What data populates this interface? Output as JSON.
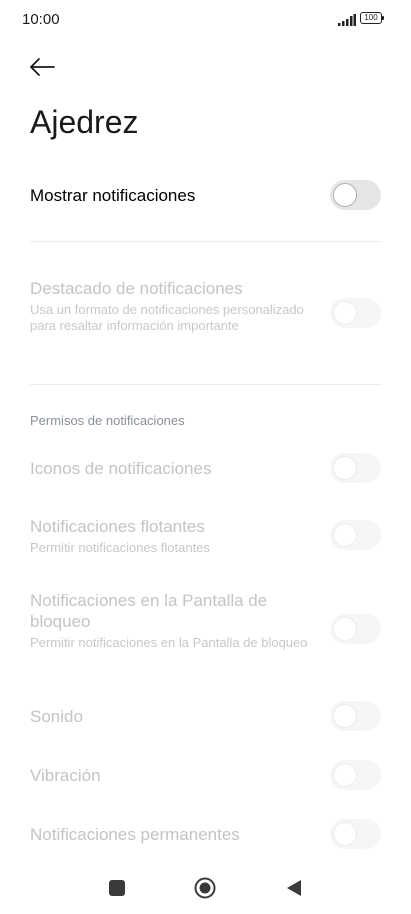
{
  "status_bar": {
    "time": "10:00",
    "battery": "100"
  },
  "header": {
    "back_icon": "arrow-left-icon",
    "title": "Ajedrez"
  },
  "settings": {
    "show_notifications": {
      "title": "Mostrar notificaciones",
      "enabled": false
    },
    "highlight": {
      "title": "Destacado de notificaciones",
      "subtitle": "Usa un formato de notificaciones personalizado para resaltar información importante",
      "enabled": false
    },
    "section_header": "Permisos de notificaciones",
    "icons": {
      "title": "Iconos de notificaciones",
      "enabled": false
    },
    "floating": {
      "title": "Notificaciones flotantes",
      "subtitle": "Permitir notificaciones flotantes",
      "enabled": false
    },
    "lockscreen": {
      "title": "Notificaciones en la Pantalla de bloqueo",
      "subtitle": "Permitir notificaciones en la Pantalla de bloqueo",
      "enabled": false
    },
    "sound": {
      "title": "Sonido",
      "enabled": false
    },
    "vibration": {
      "title": "Vibración",
      "enabled": false
    },
    "persistent": {
      "title": "Notificaciones permanentes",
      "enabled": false
    }
  },
  "nav_bar": {
    "recents_icon": "square-icon",
    "home_icon": "circle-icon",
    "back_icon": "triangle-back-icon"
  },
  "colors": {
    "disabled_text": "#c4c4c4",
    "section_header": "#8a8f9c",
    "toggle_track": "#f0f0f0"
  }
}
